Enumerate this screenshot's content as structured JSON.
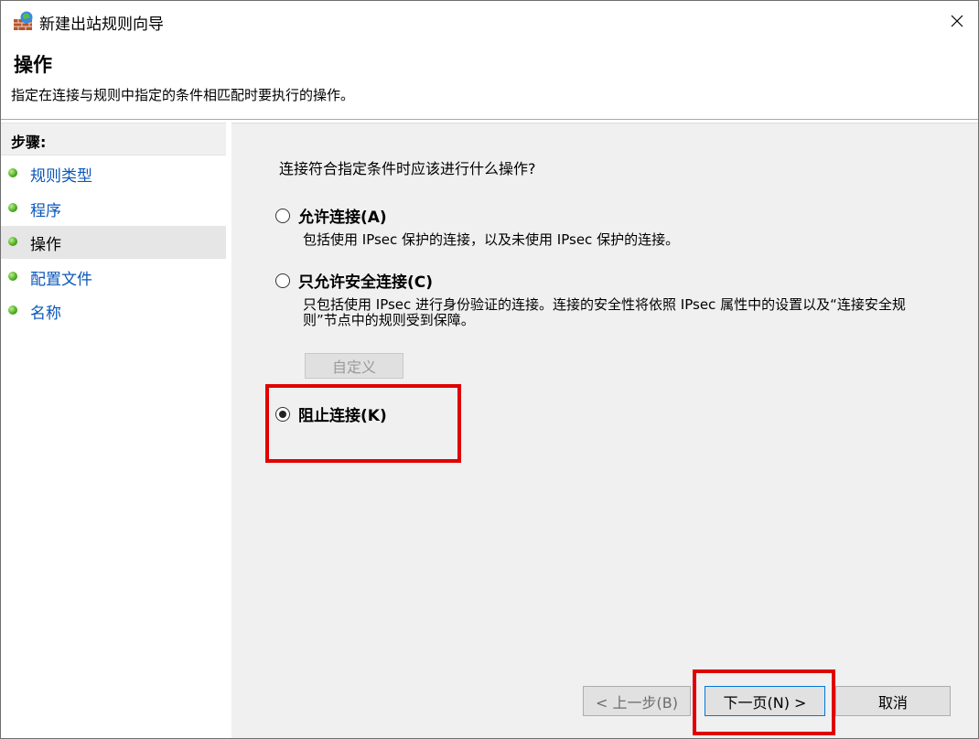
{
  "window": {
    "title": "新建出站规则向导"
  },
  "header": {
    "title": "操作",
    "description": "指定在连接与规则中指定的条件相匹配时要执行的操作。"
  },
  "steps": {
    "heading": "步骤:",
    "items": [
      {
        "label": "规则类型",
        "active": false
      },
      {
        "label": "程序",
        "active": false
      },
      {
        "label": "操作",
        "active": true
      },
      {
        "label": "配置文件",
        "active": false
      },
      {
        "label": "名称",
        "active": false
      }
    ]
  },
  "main": {
    "question": "连接符合指定条件时应该进行什么操作?",
    "options": [
      {
        "label": "允许连接(A)",
        "description": "包括使用 IPsec 保护的连接，以及未使用 IPsec 保护的连接。",
        "selected": false
      },
      {
        "label": "只允许安全连接(C)",
        "description": "只包括使用 IPsec 进行身份验证的连接。连接的安全性将依照 IPsec 属性中的设置以及“连接安全规则”节点中的规则受到保障。",
        "selected": false
      },
      {
        "label": "阻止连接(K)",
        "selected": true
      }
    ],
    "customize_label": "自定义"
  },
  "buttons": {
    "back": "< 上一步(B)",
    "next": "下一页(N) >",
    "cancel": "取消"
  },
  "colors": {
    "highlight": "#e00000",
    "link": "#0b57b9",
    "step_dot": "#4aa91e"
  }
}
